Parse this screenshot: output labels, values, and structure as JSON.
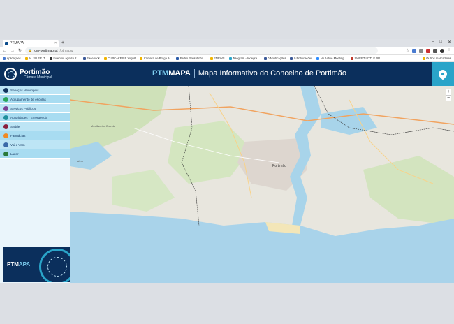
{
  "browser": {
    "tab_title": "PTMAPA",
    "new_tab": "+",
    "window_controls": [
      "–",
      "□",
      "✕"
    ],
    "url_domain": "cm-portimao.pt",
    "url_path": "/ptmapa/",
    "bookmarks": [
      "Aplicações",
      "AL SU FR IT",
      "Inventos agosto 2...",
      "Facebook",
      "CUPCAKES E Yogurt",
      "Câmara de Braga &...",
      "Pedro Pousotinho...",
      "ENEWS",
      "Telegram - Indegra...",
      "0 Notificações",
      "0 Notificações",
      "No Active Meeting...",
      "SWEET LITTLE BR..."
    ],
    "bookmarks_right": "Outros marcadores"
  },
  "header": {
    "logo_name": "Portimão",
    "logo_sub": "Câmara Municipal",
    "title_ptm": "PTM",
    "title_mapa": "MAPA",
    "subtitle": "Mapa Informativo do Concelho de Portimão"
  },
  "sidebar": {
    "items": [
      {
        "label": "Serviços Municipais",
        "icon": "municipal-icon",
        "color": "#12355f"
      },
      {
        "label": "Agrupamento de escolas",
        "icon": "school-icon",
        "color": "#2aa65a"
      },
      {
        "label": "Serviços Públicos",
        "icon": "public-services-icon",
        "color": "#7a3f93"
      },
      {
        "label": "Autoridades - Emergência",
        "icon": "emergency-icon",
        "color": "#1f8f9c"
      },
      {
        "label": "Saúde",
        "icon": "health-icon",
        "color": "#8a1f3d"
      },
      {
        "label": "Farmácias",
        "icon": "pharmacy-icon",
        "color": "#f08a24"
      },
      {
        "label": "Vai e Vem",
        "icon": "bus-icon",
        "color": "#3b6aa8"
      },
      {
        "label": "Lazer",
        "icon": "leisure-icon",
        "color": "#2b7a3b"
      }
    ],
    "promo_ptm": "PTM",
    "promo_mapa": "APA"
  },
  "map": {
    "zoom_in": "+",
    "zoom_out": "−",
    "labels": [
      "Portimão",
      "Alvor",
      "Mexilhoeira Grande"
    ]
  }
}
